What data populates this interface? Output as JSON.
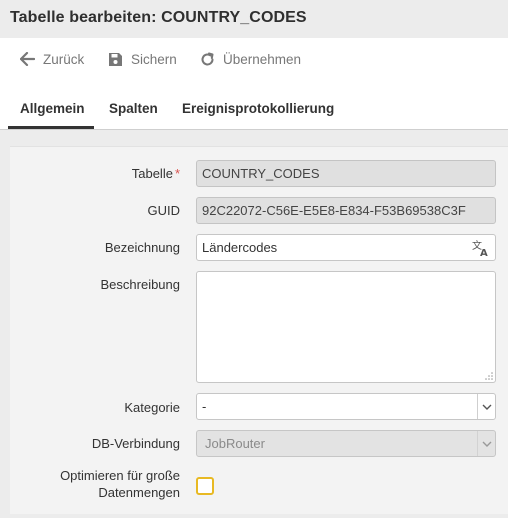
{
  "title": "Tabelle bearbeiten: COUNTRY_CODES",
  "toolbar": {
    "back_label": "Zurück",
    "save_label": "Sichern",
    "apply_label": "Übernehmen"
  },
  "tabs": [
    {
      "label": "Allgemein",
      "active": true
    },
    {
      "label": "Spalten",
      "active": false
    },
    {
      "label": "Ereignisprotokollierung",
      "active": false
    }
  ],
  "form": {
    "table_label": "Tabelle",
    "table_required_mark": "*",
    "table_value": "COUNTRY_CODES",
    "guid_label": "GUID",
    "guid_value": "92C22072-C56E-E5E8-E834-F53B69538C3F",
    "name_label": "Bezeichnung",
    "name_value": "Ländercodes",
    "description_label": "Beschreibung",
    "description_value": "",
    "category_label": "Kategorie",
    "category_value": "-",
    "db_label": "DB-Verbindung",
    "db_value": "JobRouter",
    "optimize_label_line1": "Optimieren für große",
    "optimize_label_line2": "Datenmengen",
    "optimize_checked": false
  },
  "colors": {
    "required": "#d9534f",
    "checkbox_border": "#e8b923"
  }
}
